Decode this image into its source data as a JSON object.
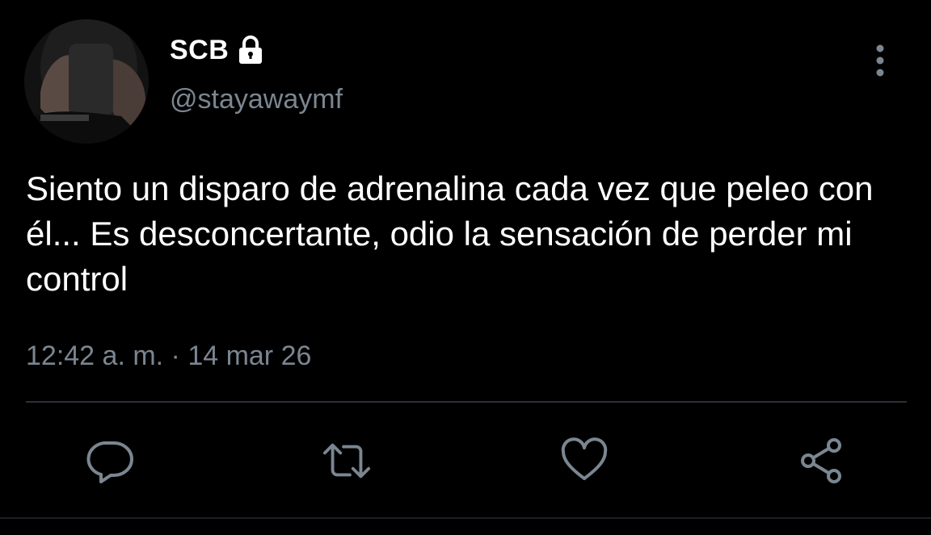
{
  "tweet": {
    "display_name": "SCB",
    "handle": "@stayawaymf",
    "text": "Siento un disparo de adrenalina cada vez que peleo con él... Es desconcertante, odio la sensación de perder mi control",
    "timestamp": "12:42 a. m. · 14 mar 26",
    "protected": true
  },
  "icons": {
    "lock": "lock-icon",
    "more": "more-vertical-icon",
    "reply": "reply-icon",
    "retweet": "retweet-icon",
    "like": "like-heart-icon",
    "share": "share-icon"
  },
  "colors": {
    "background": "#000000",
    "text": "#ffffff",
    "secondary_text": "#7b8691",
    "action_icon": "#7b8691",
    "divider": "#2b3137"
  }
}
